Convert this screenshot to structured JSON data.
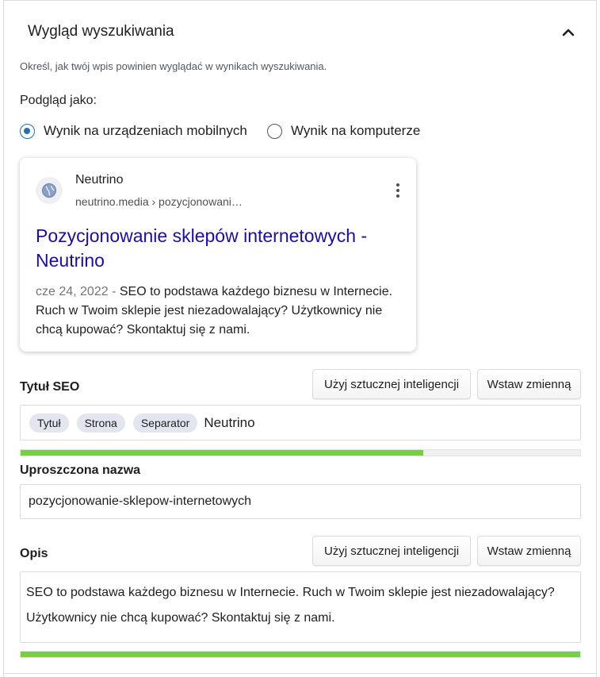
{
  "header": {
    "title": "Wygląd wyszukiwania",
    "collapse_icon": "chevron-up-icon"
  },
  "description": "Określ, jak twój wpis powinien wyglądać w wynikach wyszukiwania.",
  "preview": {
    "label": "Podgląd jako:",
    "options": [
      {
        "label": "Wynik na urządzeniach mobilnych",
        "checked": true
      },
      {
        "label": "Wynik na komputerze",
        "checked": false
      }
    ]
  },
  "serp_card": {
    "site_name": "Neutrino",
    "url": "neutrino.media › pozycjonowani…",
    "title": "Pozycjonowanie sklepów internetowych - Neutrino",
    "date": "cze 24, 2022",
    "date_separator": " - ",
    "snippet": "SEO to podstawa każdego biznesu w Internecie. Ruch w Twoim sklepie jest niezadowalający? Użytkownicy nie chcą kupować? Skontaktuj się z nami.",
    "favicon_icon": "globe-icon",
    "menu_icon": "more-vertical-icon"
  },
  "seo_title": {
    "label": "Tytuł SEO",
    "ai_button": "Użyj sztucznej inteligencji",
    "variable_button": "Wstaw zmienną",
    "chips": [
      "Tytuł",
      "Strona",
      "Separator"
    ],
    "text": "Neutrino",
    "progress": 0.72
  },
  "slug": {
    "label": "Uproszczona nazwa",
    "value": "pozycjonowanie-sklepow-internetowych"
  },
  "meta_description": {
    "label": "Opis",
    "ai_button": "Użyj sztucznej inteligencji",
    "variable_button": "Wstaw zmienną",
    "value": "SEO to podstawa każdego biznesu w Internecie. Ruch w Twoim sklepie jest niezadowalający? Użytkownicy nie chcą kupować? Skontaktuj się z nami.",
    "progress": 1.0
  },
  "colors": {
    "accent": "#2271b1",
    "link": "#1a0dab",
    "progress_good": "#7ad03a"
  }
}
